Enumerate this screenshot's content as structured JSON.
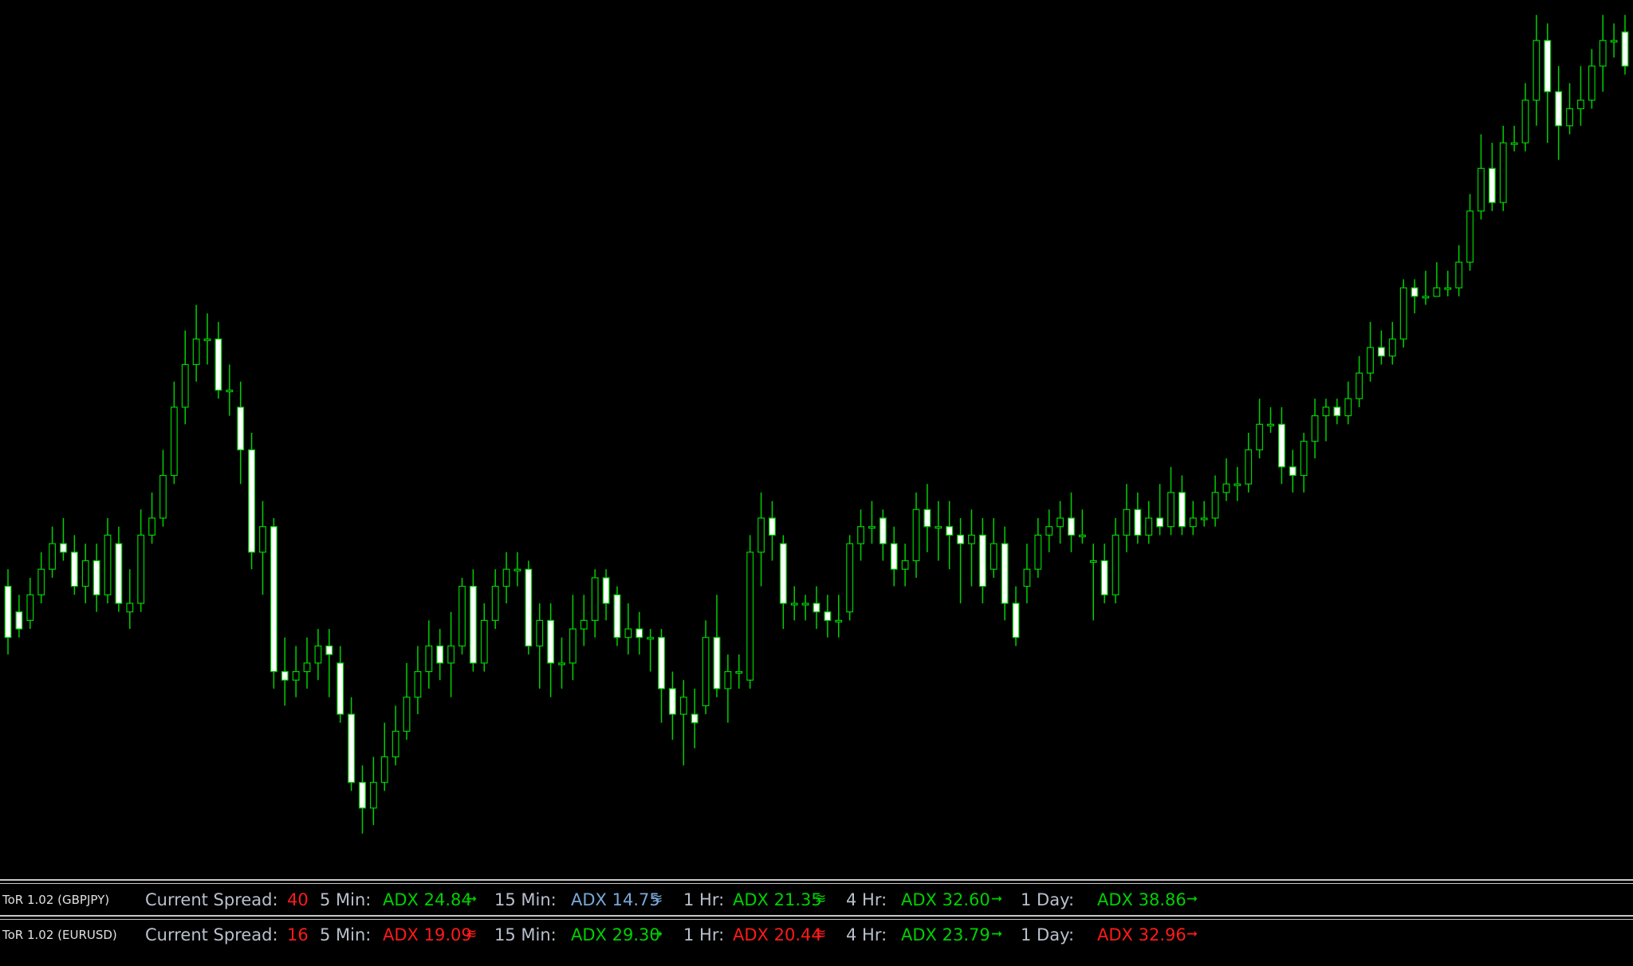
{
  "colors": {
    "background": "#000000",
    "bull": "#000000",
    "bear": "#FFFFFF",
    "wick": "#00D000",
    "green": "#00D000",
    "red": "#FF1A1A",
    "blue": "#7AA8D8",
    "label": "#B8C0CC"
  },
  "chart_data": {
    "type": "candlestick",
    "ylim": [
      0,
      100
    ],
    "candles": [
      {
        "o": 32,
        "c": 26,
        "h": 34,
        "l": 24
      },
      {
        "o": 29,
        "c": 27,
        "h": 31,
        "l": 26
      },
      {
        "o": 28,
        "c": 31,
        "h": 33,
        "l": 27
      },
      {
        "o": 31,
        "c": 34,
        "h": 36,
        "l": 30
      },
      {
        "o": 34,
        "c": 37,
        "h": 39,
        "l": 33
      },
      {
        "o": 37,
        "c": 36,
        "h": 40,
        "l": 35
      },
      {
        "o": 36,
        "c": 32,
        "h": 38,
        "l": 31
      },
      {
        "o": 32,
        "c": 35,
        "h": 37,
        "l": 30
      },
      {
        "o": 35,
        "c": 31,
        "h": 37,
        "l": 29
      },
      {
        "o": 31,
        "c": 38,
        "h": 40,
        "l": 30
      },
      {
        "o": 37,
        "c": 30,
        "h": 39,
        "l": 29
      },
      {
        "o": 29,
        "c": 30,
        "h": 34,
        "l": 27
      },
      {
        "o": 30,
        "c": 38,
        "h": 41,
        "l": 29
      },
      {
        "o": 38,
        "c": 40,
        "h": 43,
        "l": 37
      },
      {
        "o": 40,
        "c": 45,
        "h": 48,
        "l": 39
      },
      {
        "o": 45,
        "c": 53,
        "h": 56,
        "l": 44
      },
      {
        "o": 53,
        "c": 58,
        "h": 62,
        "l": 51
      },
      {
        "o": 58,
        "c": 61,
        "h": 65,
        "l": 56
      },
      {
        "o": 61,
        "c": 61,
        "h": 64,
        "l": 58
      },
      {
        "o": 61,
        "c": 55,
        "h": 63,
        "l": 54
      },
      {
        "o": 55,
        "c": 55,
        "h": 58,
        "l": 52
      },
      {
        "o": 53,
        "c": 48,
        "h": 56,
        "l": 44
      },
      {
        "o": 48,
        "c": 36,
        "h": 50,
        "l": 34
      },
      {
        "o": 36,
        "c": 39,
        "h": 42,
        "l": 31
      },
      {
        "o": 39,
        "c": 22,
        "h": 40,
        "l": 20
      },
      {
        "o": 22,
        "c": 21,
        "h": 26,
        "l": 18
      },
      {
        "o": 21,
        "c": 22,
        "h": 25,
        "l": 19
      },
      {
        "o": 22,
        "c": 23,
        "h": 26,
        "l": 20
      },
      {
        "o": 23,
        "c": 25,
        "h": 27,
        "l": 21
      },
      {
        "o": 25,
        "c": 24,
        "h": 27,
        "l": 19
      },
      {
        "o": 23,
        "c": 17,
        "h": 25,
        "l": 16
      },
      {
        "o": 17,
        "c": 9,
        "h": 19,
        "l": 8
      },
      {
        "o": 9,
        "c": 6,
        "h": 11,
        "l": 3
      },
      {
        "o": 6,
        "c": 9,
        "h": 12,
        "l": 4
      },
      {
        "o": 9,
        "c": 12,
        "h": 16,
        "l": 8
      },
      {
        "o": 12,
        "c": 15,
        "h": 18,
        "l": 11
      },
      {
        "o": 15,
        "c": 19,
        "h": 23,
        "l": 14
      },
      {
        "o": 19,
        "c": 22,
        "h": 25,
        "l": 17
      },
      {
        "o": 22,
        "c": 25,
        "h": 28,
        "l": 20
      },
      {
        "o": 25,
        "c": 23,
        "h": 27,
        "l": 21
      },
      {
        "o": 23,
        "c": 25,
        "h": 29,
        "l": 19
      },
      {
        "o": 25,
        "c": 32,
        "h": 33,
        "l": 24
      },
      {
        "o": 32,
        "c": 23,
        "h": 34,
        "l": 22
      },
      {
        "o": 23,
        "c": 28,
        "h": 30,
        "l": 22
      },
      {
        "o": 28,
        "c": 32,
        "h": 34,
        "l": 27
      },
      {
        "o": 32,
        "c": 34,
        "h": 36,
        "l": 30
      },
      {
        "o": 34,
        "c": 34,
        "h": 36,
        "l": 32
      },
      {
        "o": 34,
        "c": 25,
        "h": 35,
        "l": 24
      },
      {
        "o": 25,
        "c": 28,
        "h": 30,
        "l": 20
      },
      {
        "o": 28,
        "c": 23,
        "h": 30,
        "l": 19
      },
      {
        "o": 23,
        "c": 23,
        "h": 26,
        "l": 20
      },
      {
        "o": 23,
        "c": 27,
        "h": 31,
        "l": 21
      },
      {
        "o": 27,
        "c": 28,
        "h": 31,
        "l": 25
      },
      {
        "o": 28,
        "c": 33,
        "h": 34,
        "l": 26
      },
      {
        "o": 33,
        "c": 30,
        "h": 34,
        "l": 28
      },
      {
        "o": 31,
        "c": 26,
        "h": 32,
        "l": 25
      },
      {
        "o": 26,
        "c": 27,
        "h": 30,
        "l": 24
      },
      {
        "o": 27,
        "c": 26,
        "h": 29,
        "l": 24
      },
      {
        "o": 26,
        "c": 26,
        "h": 27,
        "l": 22
      },
      {
        "o": 26,
        "c": 20,
        "h": 27,
        "l": 16
      },
      {
        "o": 20,
        "c": 17,
        "h": 22,
        "l": 14
      },
      {
        "o": 17,
        "c": 19,
        "h": 21,
        "l": 11
      },
      {
        "o": 17,
        "c": 16,
        "h": 20,
        "l": 13
      },
      {
        "o": 18,
        "c": 26,
        "h": 28,
        "l": 17
      },
      {
        "o": 26,
        "c": 20,
        "h": 31,
        "l": 19
      },
      {
        "o": 20,
        "c": 22,
        "h": 24,
        "l": 16
      },
      {
        "o": 22,
        "c": 22,
        "h": 24,
        "l": 20
      },
      {
        "o": 21,
        "c": 36,
        "h": 38,
        "l": 20
      },
      {
        "o": 36,
        "c": 40,
        "h": 43,
        "l": 32
      },
      {
        "o": 40,
        "c": 38,
        "h": 42,
        "l": 35
      },
      {
        "o": 37,
        "c": 30,
        "h": 38,
        "l": 27
      },
      {
        "o": 30,
        "c": 30,
        "h": 32,
        "l": 28
      },
      {
        "o": 30,
        "c": 30,
        "h": 31,
        "l": 28
      },
      {
        "o": 30,
        "c": 29,
        "h": 32,
        "l": 27
      },
      {
        "o": 29,
        "c": 28,
        "h": 31,
        "l": 26
      },
      {
        "o": 28,
        "c": 28,
        "h": 31,
        "l": 26
      },
      {
        "o": 29,
        "c": 37,
        "h": 38,
        "l": 28
      },
      {
        "o": 37,
        "c": 39,
        "h": 41,
        "l": 35
      },
      {
        "o": 39,
        "c": 39,
        "h": 42,
        "l": 37
      },
      {
        "o": 40,
        "c": 37,
        "h": 41,
        "l": 35
      },
      {
        "o": 37,
        "c": 34,
        "h": 39,
        "l": 32
      },
      {
        "o": 34,
        "c": 35,
        "h": 37,
        "l": 32
      },
      {
        "o": 35,
        "c": 41,
        "h": 43,
        "l": 33
      },
      {
        "o": 41,
        "c": 39,
        "h": 44,
        "l": 36
      },
      {
        "o": 39,
        "c": 39,
        "h": 42,
        "l": 35
      },
      {
        "o": 39,
        "c": 38,
        "h": 42,
        "l": 34
      },
      {
        "o": 38,
        "c": 37,
        "h": 40,
        "l": 30
      },
      {
        "o": 37,
        "c": 38,
        "h": 41,
        "l": 32
      },
      {
        "o": 38,
        "c": 32,
        "h": 40,
        "l": 30
      },
      {
        "o": 34,
        "c": 37,
        "h": 40,
        "l": 33
      },
      {
        "o": 37,
        "c": 30,
        "h": 39,
        "l": 28
      },
      {
        "o": 30,
        "c": 26,
        "h": 32,
        "l": 25
      },
      {
        "o": 32,
        "c": 34,
        "h": 37,
        "l": 30
      },
      {
        "o": 34,
        "c": 38,
        "h": 40,
        "l": 33
      },
      {
        "o": 38,
        "c": 39,
        "h": 41,
        "l": 36
      },
      {
        "o": 39,
        "c": 40,
        "h": 42,
        "l": 37
      },
      {
        "o": 40,
        "c": 38,
        "h": 43,
        "l": 36
      },
      {
        "o": 38,
        "c": 38,
        "h": 41,
        "l": 37
      },
      {
        "o": 35,
        "c": 35,
        "h": 37,
        "l": 28
      },
      {
        "o": 35,
        "c": 31,
        "h": 37,
        "l": 30
      },
      {
        "o": 31,
        "c": 38,
        "h": 40,
        "l": 30
      },
      {
        "o": 38,
        "c": 41,
        "h": 44,
        "l": 36
      },
      {
        "o": 41,
        "c": 38,
        "h": 43,
        "l": 37
      },
      {
        "o": 38,
        "c": 40,
        "h": 42,
        "l": 37
      },
      {
        "o": 40,
        "c": 39,
        "h": 44,
        "l": 38
      },
      {
        "o": 39,
        "c": 43,
        "h": 46,
        "l": 38
      },
      {
        "o": 43,
        "c": 39,
        "h": 45,
        "l": 38
      },
      {
        "o": 39,
        "c": 40,
        "h": 42,
        "l": 38
      },
      {
        "o": 40,
        "c": 40,
        "h": 42,
        "l": 39
      },
      {
        "o": 40,
        "c": 43,
        "h": 45,
        "l": 39
      },
      {
        "o": 43,
        "c": 44,
        "h": 47,
        "l": 42
      },
      {
        "o": 44,
        "c": 44,
        "h": 46,
        "l": 42
      },
      {
        "o": 44,
        "c": 48,
        "h": 50,
        "l": 43
      },
      {
        "o": 48,
        "c": 51,
        "h": 54,
        "l": 47
      },
      {
        "o": 51,
        "c": 51,
        "h": 53,
        "l": 50
      },
      {
        "o": 51,
        "c": 46,
        "h": 53,
        "l": 44
      },
      {
        "o": 46,
        "c": 45,
        "h": 48,
        "l": 43
      },
      {
        "o": 45,
        "c": 49,
        "h": 50,
        "l": 43
      },
      {
        "o": 49,
        "c": 52,
        "h": 54,
        "l": 47
      },
      {
        "o": 52,
        "c": 53,
        "h": 54,
        "l": 49
      },
      {
        "o": 53,
        "c": 52,
        "h": 54,
        "l": 51
      },
      {
        "o": 52,
        "c": 54,
        "h": 56,
        "l": 51
      },
      {
        "o": 54,
        "c": 57,
        "h": 59,
        "l": 53
      },
      {
        "o": 57,
        "c": 60,
        "h": 63,
        "l": 56
      },
      {
        "o": 60,
        "c": 59,
        "h": 62,
        "l": 58
      },
      {
        "o": 59,
        "c": 61,
        "h": 63,
        "l": 58
      },
      {
        "o": 61,
        "c": 67,
        "h": 68,
        "l": 60
      },
      {
        "o": 67,
        "c": 66,
        "h": 68,
        "l": 64
      },
      {
        "o": 66,
        "c": 66,
        "h": 69,
        "l": 65
      },
      {
        "o": 66,
        "c": 67,
        "h": 70,
        "l": 66
      },
      {
        "o": 67,
        "c": 67,
        "h": 69,
        "l": 66
      },
      {
        "o": 67,
        "c": 70,
        "h": 72,
        "l": 66
      },
      {
        "o": 70,
        "c": 76,
        "h": 78,
        "l": 69
      },
      {
        "o": 76,
        "c": 81,
        "h": 85,
        "l": 75
      },
      {
        "o": 81,
        "c": 77,
        "h": 84,
        "l": 76
      },
      {
        "o": 77,
        "c": 84,
        "h": 86,
        "l": 76
      },
      {
        "o": 84,
        "c": 84,
        "h": 86,
        "l": 83
      },
      {
        "o": 84,
        "c": 89,
        "h": 91,
        "l": 83
      },
      {
        "o": 89,
        "c": 96,
        "h": 99,
        "l": 86
      },
      {
        "o": 96,
        "c": 90,
        "h": 98,
        "l": 84
      },
      {
        "o": 90,
        "c": 86,
        "h": 93,
        "l": 82
      },
      {
        "o": 86,
        "c": 88,
        "h": 91,
        "l": 85
      },
      {
        "o": 88,
        "c": 89,
        "h": 93,
        "l": 86
      },
      {
        "o": 89,
        "c": 93,
        "h": 95,
        "l": 88
      },
      {
        "o": 93,
        "c": 96,
        "h": 99,
        "l": 90
      },
      {
        "o": 96,
        "c": 96,
        "h": 98,
        "l": 94
      },
      {
        "o": 97,
        "c": 93,
        "h": 99,
        "l": 92
      }
    ]
  },
  "indicators": [
    {
      "name": "ToR 1.02 (GBPJPY)",
      "spread_label": "Current Spread:",
      "spread": "40",
      "spread_color": "#FF1A1A",
      "timeframes": [
        {
          "label": "5 Min:",
          "value": "ADX 24.84",
          "color": "#00D000",
          "icon": "➞"
        },
        {
          "label": "15 Min:",
          "value": "ADX 14.75",
          "color": "#7AA8D8",
          "icon": "≋"
        },
        {
          "label": "1 Hr:",
          "value": "ADX 21.35",
          "color": "#00D000",
          "icon": "≋"
        },
        {
          "label": "4 Hr:",
          "value": "ADX 32.60",
          "color": "#00D000",
          "icon": "➞"
        },
        {
          "label": "1 Day:",
          "value": "ADX 38.86",
          "color": "#00D000",
          "icon": "➞"
        }
      ]
    },
    {
      "name": "ToR 1.02 (EURUSD)",
      "spread_label": "Current Spread:",
      "spread": "16",
      "spread_color": "#FF1A1A",
      "timeframes": [
        {
          "label": "5 Min:",
          "value": "ADX 19.09",
          "color": "#FF1A1A",
          "icon": "≋"
        },
        {
          "label": "15 Min:",
          "value": "ADX 29.30",
          "color": "#00D000",
          "icon": "➞"
        },
        {
          "label": "1 Hr:",
          "value": "ADX 20.44",
          "color": "#FF1A1A",
          "icon": "≋"
        },
        {
          "label": "4 Hr:",
          "value": "ADX 23.79",
          "color": "#00D000",
          "icon": "➞"
        },
        {
          "label": "1 Day:",
          "value": "ADX 32.96",
          "color": "#FF1A1A",
          "icon": "➞"
        }
      ]
    }
  ]
}
